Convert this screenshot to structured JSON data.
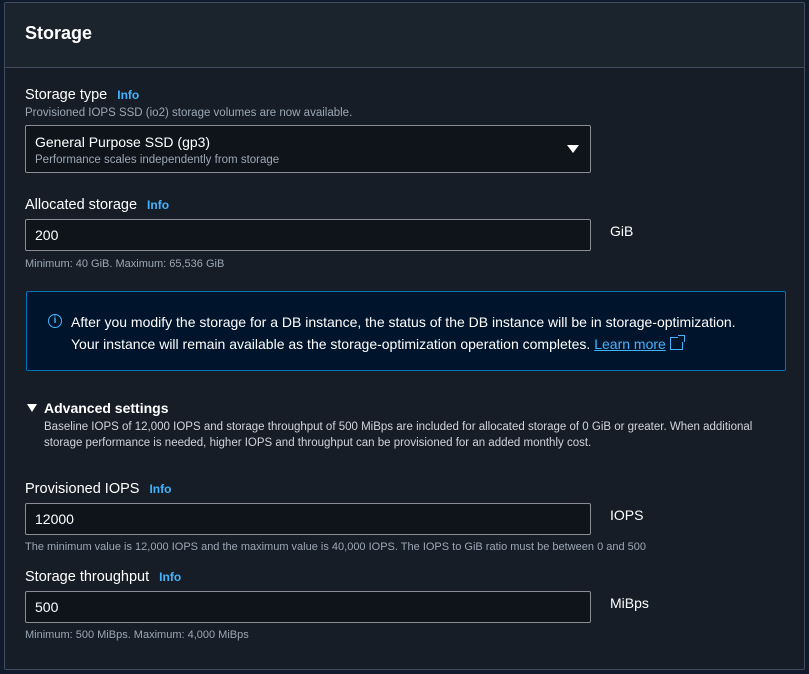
{
  "section": {
    "title": "Storage"
  },
  "storage_type": {
    "label": "Storage type",
    "info": "Info",
    "description": "Provisioned IOPS SSD (io2) storage volumes are now available.",
    "selected": "General Purpose SSD (gp3)",
    "selected_sub": "Performance scales independently from storage"
  },
  "allocated_storage": {
    "label": "Allocated storage",
    "info": "Info",
    "value": "200",
    "unit": "GiB",
    "constraint": "Minimum: 40 GiB. Maximum: 65,536 GiB"
  },
  "alert": {
    "line1": "After you modify the storage for a DB instance, the status of the DB instance will be in storage-optimization.",
    "line2": "Your instance will remain available as the storage-optimization operation completes.",
    "link": "Learn more"
  },
  "advanced": {
    "title": "Advanced settings",
    "description": "Baseline IOPS of 12,000 IOPS and storage throughput of 500 MiBps are included for allocated storage of 0 GiB or greater. When additional storage performance is needed, higher IOPS and throughput can be provisioned for an added monthly cost."
  },
  "iops": {
    "label": "Provisioned IOPS",
    "info": "Info",
    "value": "12000",
    "unit": "IOPS",
    "constraint": "The minimum value is 12,000 IOPS and the maximum value is 40,000 IOPS. The IOPS to GiB ratio must be between 0 and 500"
  },
  "throughput": {
    "label": "Storage throughput",
    "info": "Info",
    "value": "500",
    "unit": "MiBps",
    "constraint": "Minimum: 500 MiBps. Maximum: 4,000 MiBps"
  },
  "colors": {
    "accent": "#42b4ff",
    "alert_border": "#0073bb",
    "panel_bg": "#161d26"
  }
}
